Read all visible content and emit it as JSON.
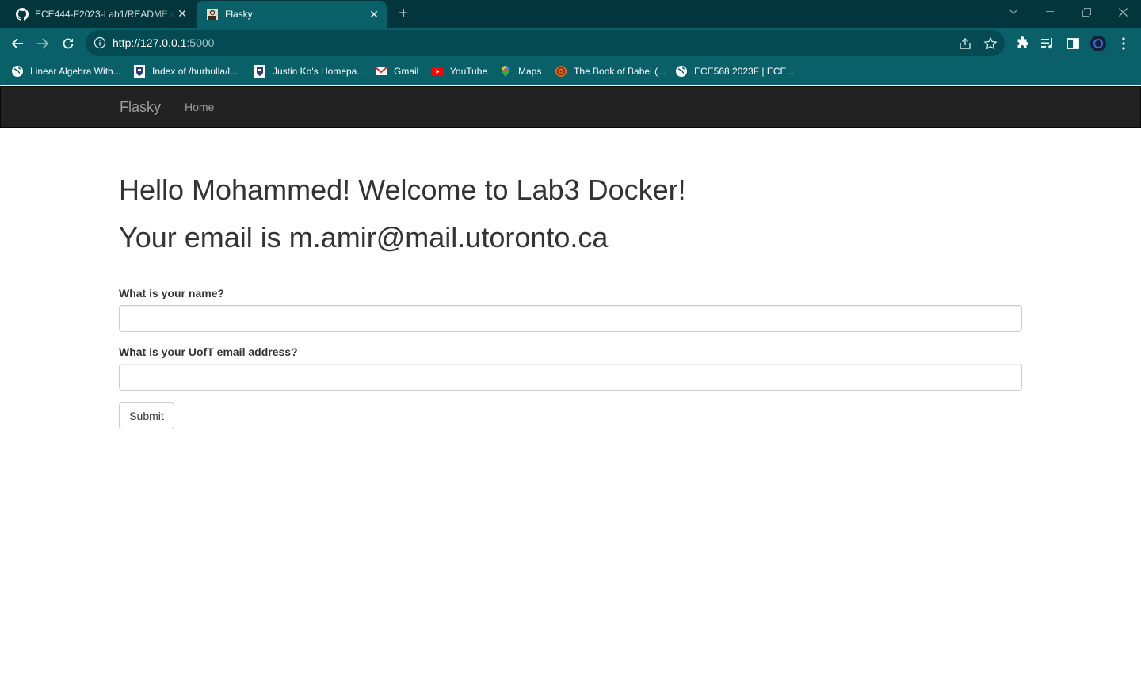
{
  "browser": {
    "tabs": [
      {
        "title": "ECE444-F2023-Lab1/README.md",
        "icon": "github-icon"
      },
      {
        "title": "Flasky",
        "icon": "flask-avatar-icon"
      }
    ],
    "new_tab_glyph": "+",
    "close_glyph": "✕",
    "window_controls": [
      "tab-search",
      "minimize",
      "restore",
      "close"
    ],
    "url_host": "http://127.0.0.1",
    "url_port": ":5000",
    "bookmarks": [
      {
        "label": "Linear Algebra With...",
        "icon": "globe-icon"
      },
      {
        "label": "Index of /burbulla/l...",
        "icon": "crest-icon"
      },
      {
        "label": "Justin Ko's Homepa...",
        "icon": "crest-icon"
      },
      {
        "label": "Gmail",
        "icon": "gmail-icon"
      },
      {
        "label": "YouTube",
        "icon": "youtube-icon"
      },
      {
        "label": "Maps",
        "icon": "maps-icon"
      },
      {
        "label": "The Book of Babel (...",
        "icon": "babel-icon"
      },
      {
        "label": "ECE568 2023F | ECE...",
        "icon": "globe-icon"
      }
    ],
    "colors": {
      "tabstrip": "#03353d",
      "toolbar": "#0a6069",
      "omnibox": "#044a52"
    }
  },
  "navbar": {
    "brand": "Flasky",
    "home": "Home"
  },
  "main": {
    "greeting": "Hello Mohammed! Welcome to Lab3 Docker!",
    "email_line": "Your email is m.amir@mail.utoronto.ca",
    "name_label": "What is your name?",
    "name_value": "",
    "email_label": "What is your UofT email address?",
    "email_value": "",
    "submit_label": "Submit"
  }
}
